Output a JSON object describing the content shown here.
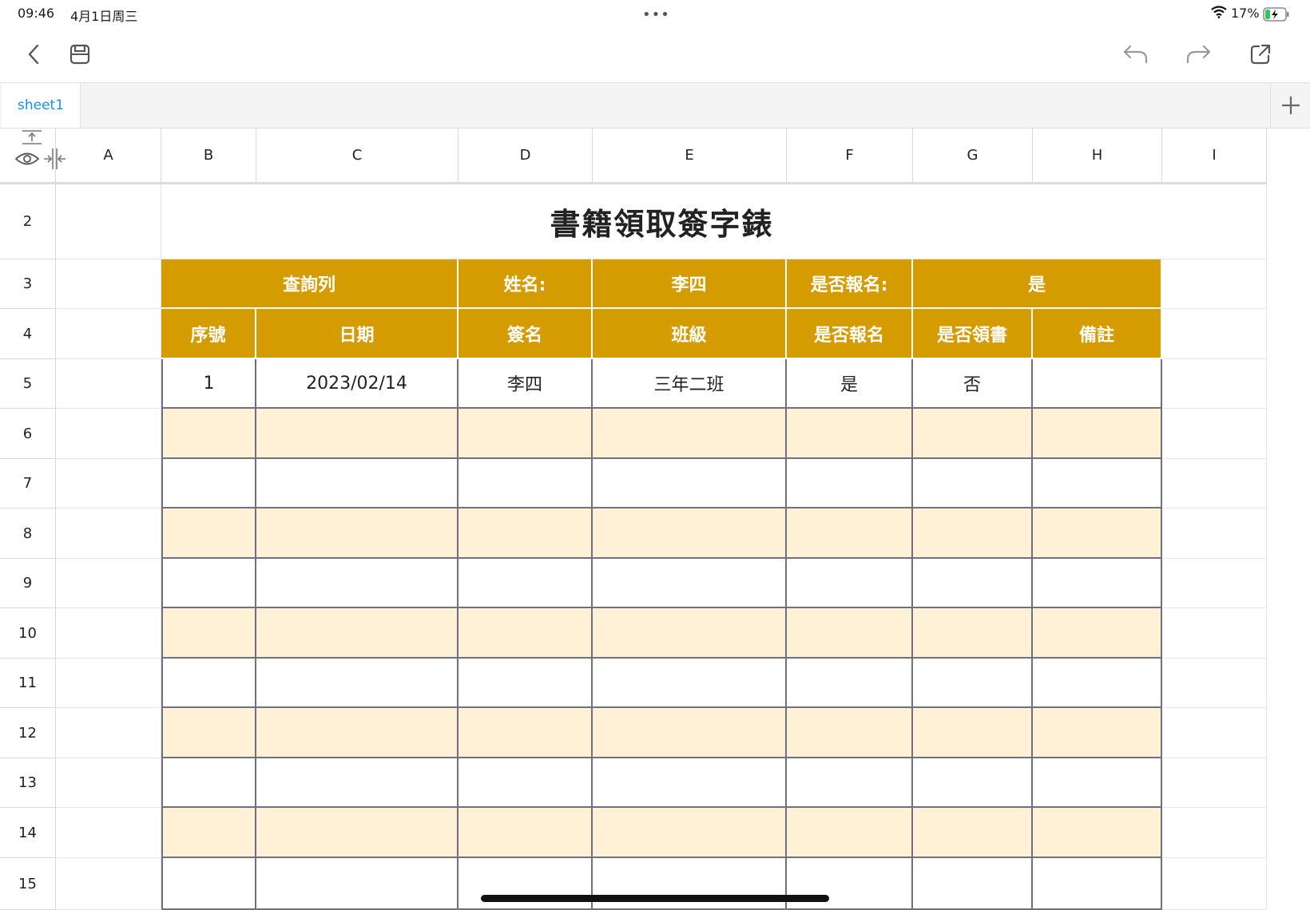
{
  "status_bar": {
    "time": "09:46",
    "date": "4月1日周三",
    "battery_percent": "17%"
  },
  "toolbar": {
    "back": "chevron-left-icon",
    "save": "floppy-disk-icon",
    "undo": "undo-icon",
    "redo": "redo-icon",
    "share": "share-icon"
  },
  "tabs": [
    {
      "label": "sheet1",
      "active": true
    }
  ],
  "add_tab": "+",
  "columns": [
    "A",
    "B",
    "C",
    "D",
    "E",
    "F",
    "G",
    "H",
    "I"
  ],
  "row_numbers": [
    "2",
    "3",
    "4",
    "5",
    "6",
    "7",
    "8",
    "9",
    "10",
    "11",
    "12",
    "13",
    "14",
    "15"
  ],
  "sheet": {
    "title": "書籍領取簽字錶",
    "query_row": {
      "query_label": "查詢列",
      "name_label": "姓名:",
      "name_value": "李四",
      "registered_label": "是否報名:",
      "registered_value": "是"
    },
    "headers": [
      "序號",
      "日期",
      "簽名",
      "班級",
      "是否報名",
      "是否領書",
      "備註"
    ],
    "rows": [
      [
        "1",
        "2023/02/14",
        "李四",
        "三年二班",
        "是",
        "否",
        ""
      ],
      [
        "",
        "",
        "",
        "",
        "",
        "",
        ""
      ],
      [
        "",
        "",
        "",
        "",
        "",
        "",
        ""
      ],
      [
        "",
        "",
        "",
        "",
        "",
        "",
        ""
      ],
      [
        "",
        "",
        "",
        "",
        "",
        "",
        ""
      ],
      [
        "",
        "",
        "",
        "",
        "",
        "",
        ""
      ],
      [
        "",
        "",
        "",
        "",
        "",
        "",
        ""
      ],
      [
        "",
        "",
        "",
        "",
        "",
        "",
        ""
      ],
      [
        "",
        "",
        "",
        "",
        "",
        "",
        ""
      ],
      [
        "",
        "",
        "",
        "",
        "",
        "",
        ""
      ],
      [
        "",
        "",
        "",
        "",
        "",
        "",
        ""
      ]
    ]
  },
  "colors": {
    "header_gold": "#d49c00",
    "stripe": "#fff1d6",
    "link_blue": "#1a8fe6"
  }
}
